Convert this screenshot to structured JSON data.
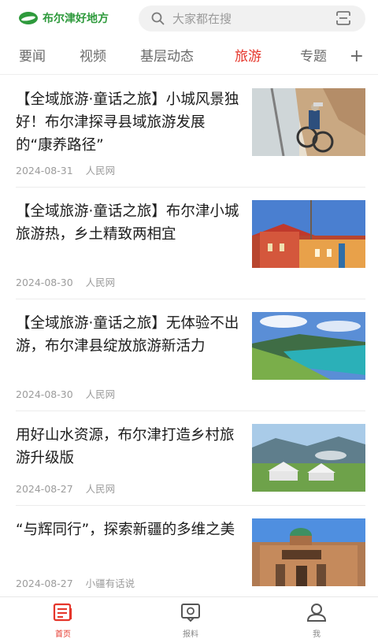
{
  "header": {
    "logo_text": "布尔津好地方",
    "search_placeholder": "大家都在搜",
    "icons": [
      "search-icon",
      "scan-icon"
    ]
  },
  "tabs": [
    {
      "label": "要闻",
      "active": false
    },
    {
      "label": "视频",
      "active": false
    },
    {
      "label": "基层动态",
      "active": false
    },
    {
      "label": "旅游",
      "active": true
    },
    {
      "label": "专题",
      "active": false
    }
  ],
  "tabs_more": "+",
  "articles": [
    {
      "title": "【全域旅游·童话之旅】小城风景独好！布尔津探寻县域旅游发展的“康养路径”",
      "date": "2024-08-31",
      "source": "人民网"
    },
    {
      "title": "【全域旅游·童话之旅】布尔津小城旅游热，乡土精致两相宜",
      "date": "2024-08-30",
      "source": "人民网"
    },
    {
      "title": "【全域旅游·童话之旅】无体验不出游，布尔津县绽放旅游新活力",
      "date": "2024-08-30",
      "source": "人民网"
    },
    {
      "title": "用好山水资源，布尔津打造乡村旅游升级版",
      "date": "2024-08-27",
      "source": "人民网"
    },
    {
      "title": "“与辉同行”，探索新疆的多维之美",
      "date": "2024-08-27",
      "source": "小疆有话说"
    }
  ],
  "bottom_nav": [
    {
      "label": "首页",
      "icon": "news-icon",
      "active": true
    },
    {
      "label": "报料",
      "icon": "report-icon",
      "active": false
    },
    {
      "label": "我",
      "icon": "user-icon",
      "active": false
    }
  ],
  "colors": {
    "accent": "#e5352a",
    "brand_green": "#2e9a3c"
  }
}
